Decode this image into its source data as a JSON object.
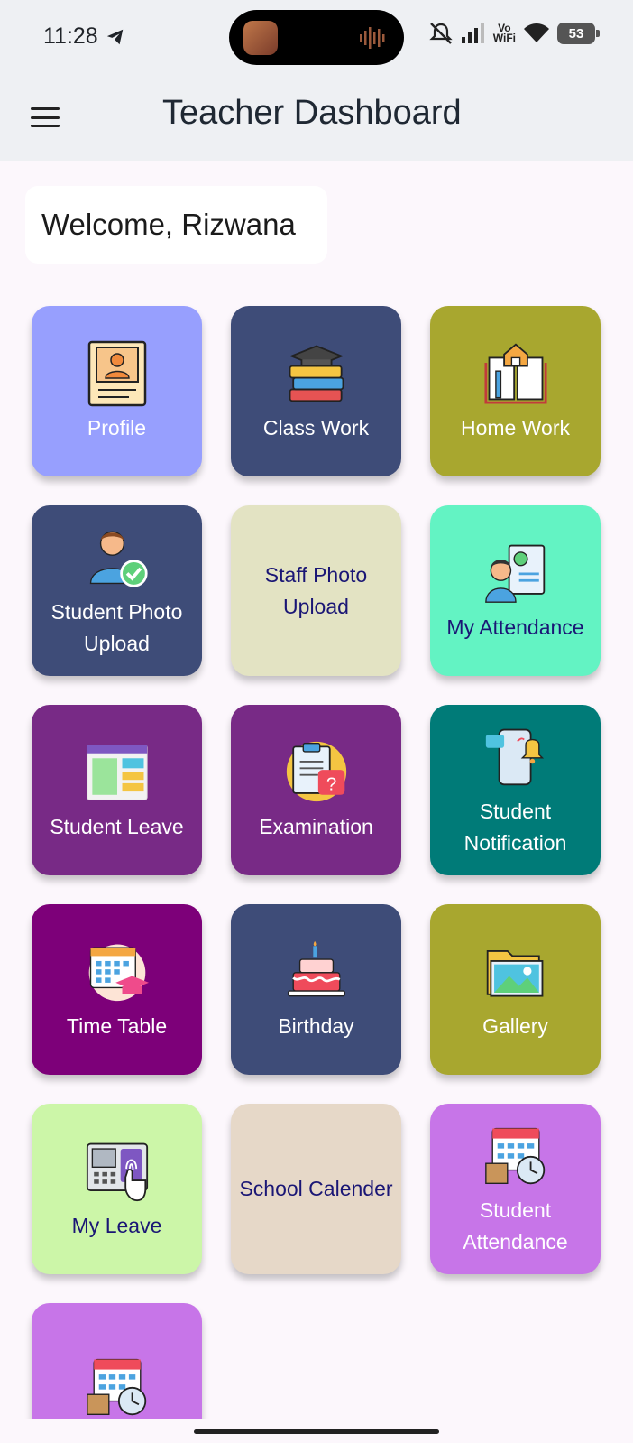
{
  "status": {
    "time": "11:28",
    "battery": "53",
    "vowifi_top": "Vo",
    "vowifi_bottom": "WiFi"
  },
  "app_bar": {
    "title": "Teacher Dashboard"
  },
  "welcome": {
    "text": "Welcome, Rizwana"
  },
  "colors": {
    "profile": "#979ffe",
    "navy": "#3e4c78",
    "olive": "#a8a72f",
    "cream": "#e3e3c3",
    "mint": "#63f3c3",
    "purple": "#782a86",
    "teal": "#007b78",
    "magenta": "#7d0079",
    "lightgreen": "#ccf6a8",
    "beige": "#e6d8c8",
    "lilac": "#c775e8"
  },
  "tiles": [
    {
      "label": "Profile",
      "icon": "profile-card-icon"
    },
    {
      "label": "Class Work",
      "icon": "books-graduation-cap-icon"
    },
    {
      "label": "Home Work",
      "icon": "open-book-house-icon"
    },
    {
      "label": "Student Photo Upload",
      "icon": "student-check-icon"
    },
    {
      "label": "Staff Photo Upload",
      "icon": ""
    },
    {
      "label": "My Attendance",
      "icon": "teacher-clipboard-icon"
    },
    {
      "label": "Student Leave",
      "icon": "browser-layout-icon"
    },
    {
      "label": "Examination",
      "icon": "exam-clipboard-question-icon"
    },
    {
      "label": "Student Notification",
      "icon": "phone-bell-icon"
    },
    {
      "label": "Time Table",
      "icon": "calendar-cap-icon"
    },
    {
      "label": "Birthday",
      "icon": "birthday-cake-icon"
    },
    {
      "label": "Gallery",
      "icon": "photo-folder-icon"
    },
    {
      "label": "My Leave",
      "icon": "fingerprint-scanner-icon"
    },
    {
      "label": "School Calender",
      "icon": ""
    },
    {
      "label": "Student Attendance",
      "icon": "calendar-clock-box-icon"
    },
    {
      "label": "",
      "icon": "calendar-clock-box-icon"
    }
  ]
}
